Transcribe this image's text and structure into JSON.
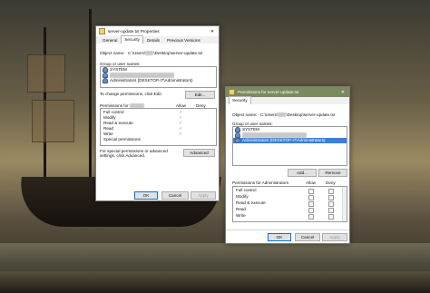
{
  "colors": {
    "selection": "#3c7fd6",
    "primary_border": "#0078d7",
    "perm_titlebar": "#7a8a5e"
  },
  "props": {
    "title": "server-update.txt Properties",
    "tabs": [
      "General",
      "Security",
      "Details",
      "Previous Versions"
    ],
    "object_name_label": "Object name:",
    "object_name_value": "C:\\Users\\",
    "object_name_value2": "\\Desktop\\server-update.txt",
    "group_label": "Group or user names:",
    "users": [
      "SYSTEM",
      "",
      "Administrators (DESKTOP-I7\\Administrators)"
    ],
    "change_text": "To change permissions, click Edit.",
    "edit_label": "Edit...",
    "perms_header": "Permissions for",
    "allow": "Allow",
    "deny": "Deny",
    "perm_names": [
      "Full control",
      "Modify",
      "Read & execute",
      "Read",
      "Write",
      "Special permissions"
    ],
    "allow_checks": [
      true,
      true,
      true,
      true,
      true,
      false
    ],
    "special_text": "For special permissions or advanced settings, click Advanced.",
    "advanced_label": "Advanced",
    "ok": "OK",
    "cancel": "Cancel",
    "apply": "Apply"
  },
  "perm": {
    "title": "Permissions for server-update.txt",
    "tab": "Security",
    "object_name_label": "Object name:",
    "object_name_value": "C:\\Users\\",
    "object_name_value2": "\\Desktop\\server-update.txt",
    "group_label": "Group or user names:",
    "users": [
      "SYSTEM",
      "",
      "Administrators (DESKTOP-I7\\Administrators)"
    ],
    "selected_index": 2,
    "add_label": "Add...",
    "remove_label": "Remove",
    "perms_header": "Permissions for Administrators",
    "allow": "Allow",
    "deny": "Deny",
    "perm_names": [
      "Full control",
      "Modify",
      "Read & execute",
      "Read",
      "Write"
    ],
    "ok": "OK",
    "cancel": "Cancel",
    "apply": "Apply"
  }
}
